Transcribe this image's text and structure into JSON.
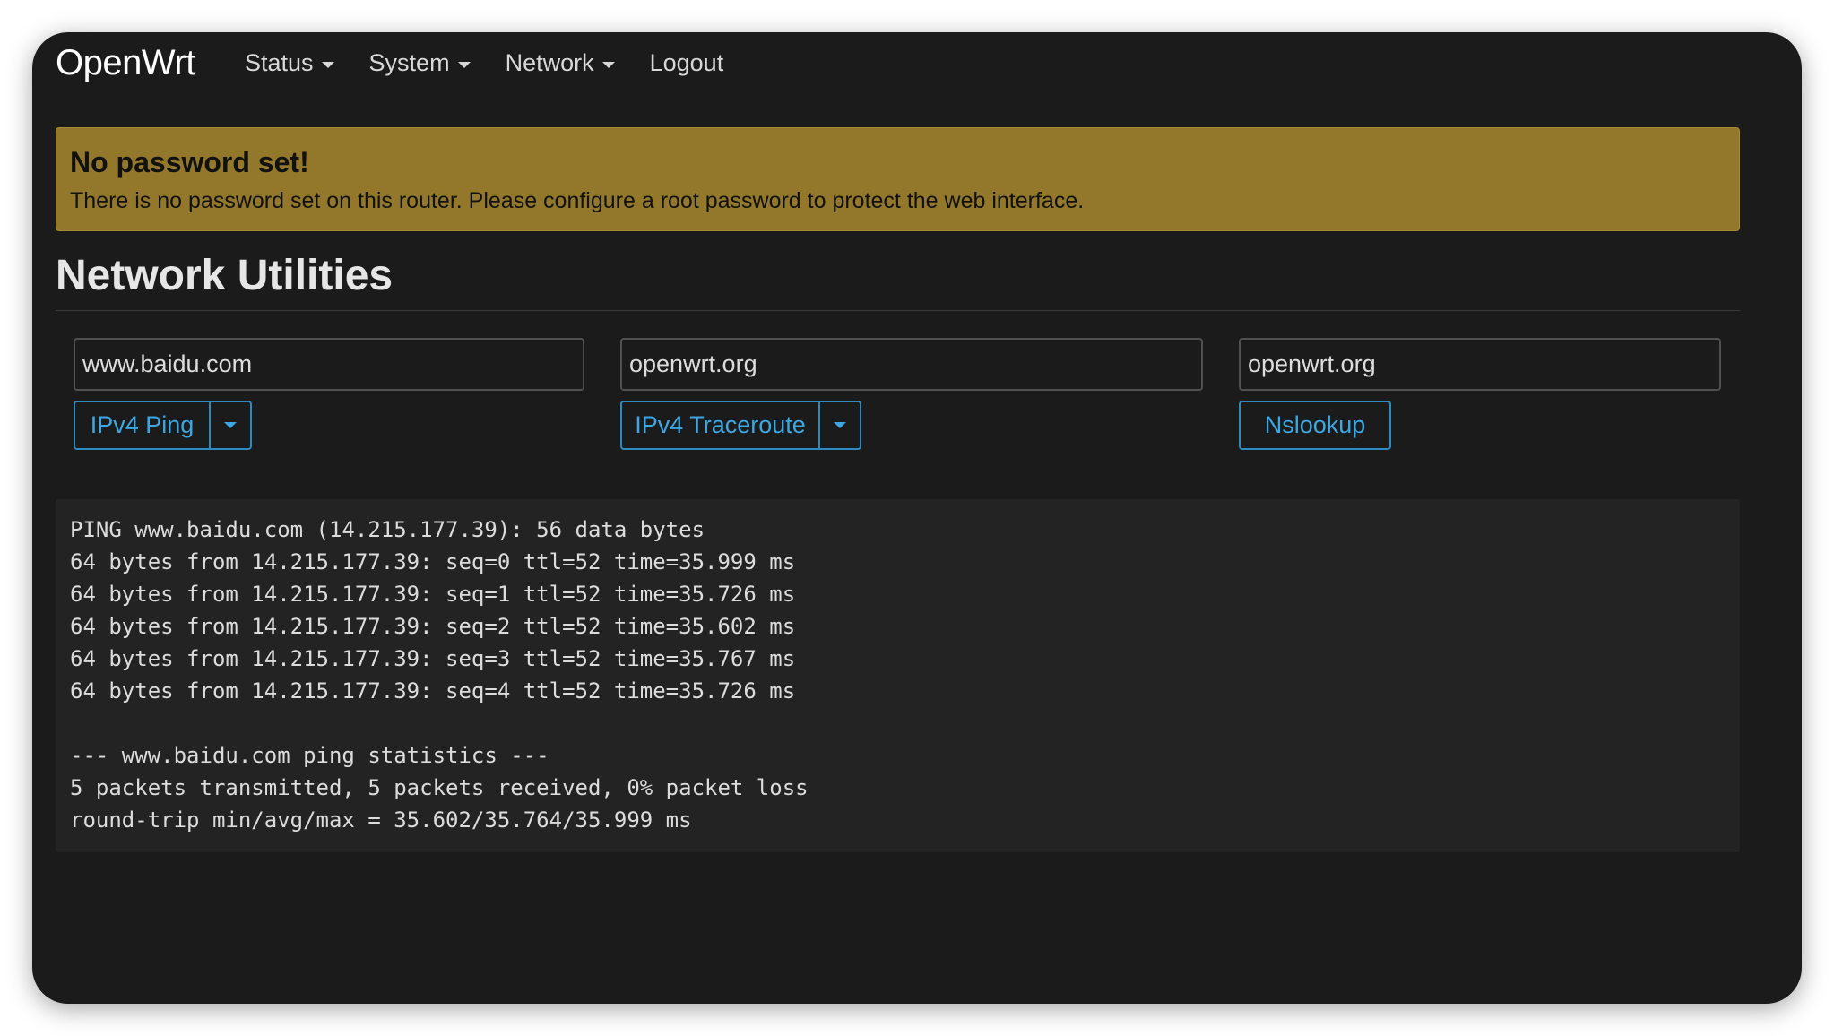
{
  "nav": {
    "brand": "OpenWrt",
    "menu": [
      {
        "label": "Status"
      },
      {
        "label": "System"
      },
      {
        "label": "Network"
      },
      {
        "label": "Logout"
      }
    ]
  },
  "alert": {
    "title": "No password set!",
    "text": "There is no password set on this router. Please configure a root password to protect the web interface."
  },
  "page": {
    "title": "Network Utilities"
  },
  "tools": {
    "ping": {
      "input_value": "www.baidu.com",
      "button_label": "IPv4 Ping"
    },
    "traceroute": {
      "input_value": "openwrt.org",
      "button_label": "IPv4 Traceroute"
    },
    "nslookup": {
      "input_value": "openwrt.org",
      "button_label": "Nslookup"
    }
  },
  "output": {
    "lines": [
      "PING www.baidu.com (14.215.177.39): 56 data bytes",
      "64 bytes from 14.215.177.39: seq=0 ttl=52 time=35.999 ms",
      "64 bytes from 14.215.177.39: seq=1 ttl=52 time=35.726 ms",
      "64 bytes from 14.215.177.39: seq=2 ttl=52 time=35.602 ms",
      "64 bytes from 14.215.177.39: seq=3 ttl=52 time=35.767 ms",
      "64 bytes from 14.215.177.39: seq=4 ttl=52 time=35.726 ms",
      "",
      "--- www.baidu.com ping statistics ---",
      "5 packets transmitted, 5 packets received, 0% packet loss",
      "round-trip min/avg/max = 35.602/35.764/35.999 ms"
    ]
  },
  "colors": {
    "background": "#1b1b1b",
    "alert": "#93782c",
    "accent": "#3ea6e0"
  }
}
